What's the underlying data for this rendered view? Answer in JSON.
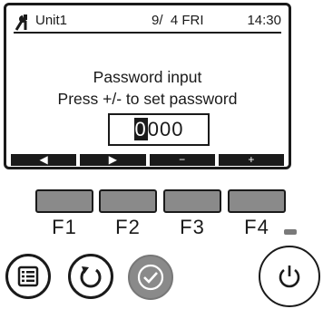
{
  "status": {
    "unit": "Unit1",
    "date": "9/  4 FRI",
    "time": "14:30",
    "icon": "wrench-screwdriver-icon"
  },
  "message": {
    "line1": "Password input",
    "line2": "Press +/- to set password"
  },
  "password": {
    "cursor_digit": "0",
    "rest": "000"
  },
  "fkey_bar": [
    "◀",
    "▶",
    "−",
    "+"
  ],
  "fkeys": [
    "F1",
    "F2",
    "F3",
    "F4"
  ],
  "buttons": {
    "menu": "menu-icon",
    "back": "return-icon",
    "ok": "check-icon",
    "power": "power-icon"
  }
}
